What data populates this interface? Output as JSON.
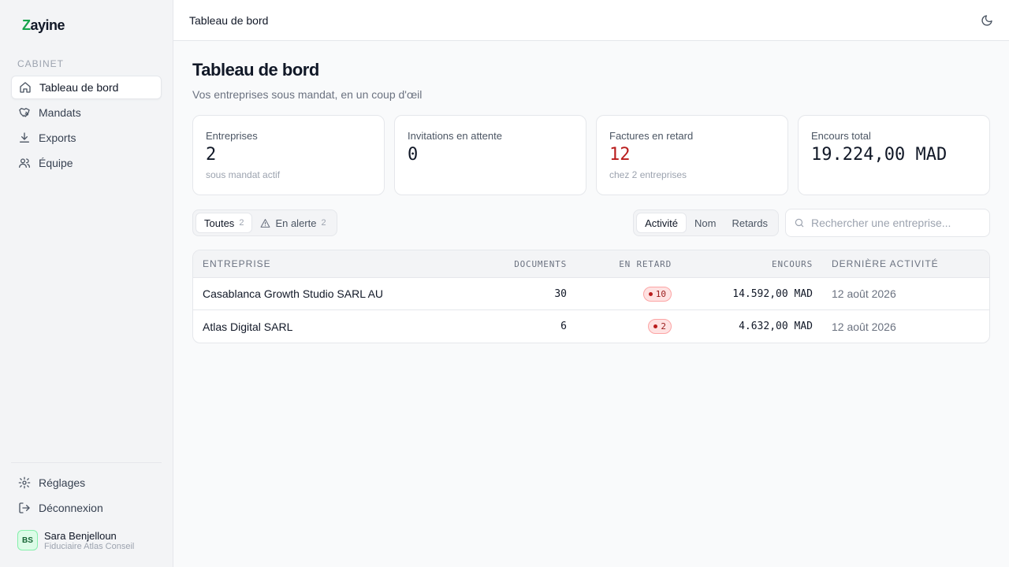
{
  "app": {
    "logo_z": "Z",
    "logo_rest": "ayine"
  },
  "sidebar": {
    "section": "CABINET",
    "items": [
      {
        "label": "Tableau de bord",
        "icon": "home-icon",
        "active": true
      },
      {
        "label": "Mandats",
        "icon": "handshake-icon"
      },
      {
        "label": "Exports",
        "icon": "download-icon"
      },
      {
        "label": "Équipe",
        "icon": "users-icon"
      }
    ],
    "bottom": [
      {
        "label": "Réglages",
        "icon": "gear-icon"
      },
      {
        "label": "Déconnexion",
        "icon": "logout-icon"
      }
    ],
    "user": {
      "initials": "BS",
      "name": "Sara Benjelloun",
      "org": "Fiduciaire Atlas Conseil"
    }
  },
  "topbar": {
    "title": "Tableau de bord",
    "icon": "moon-icon"
  },
  "page": {
    "title": "Tableau de bord",
    "subtitle": "Vos entreprises sous mandat, en un coup d'œil"
  },
  "cards": [
    {
      "label": "Entreprises",
      "value": "2",
      "sub": "sous mandat actif"
    },
    {
      "label": "Invitations en attente",
      "value": "0",
      "sub": ""
    },
    {
      "label": "Factures en retard",
      "value": "12",
      "sub": "chez 2 entreprises",
      "accent": "#b91c1c"
    },
    {
      "label": "Encours total",
      "value": "19.224,00 MAD",
      "sub": ""
    }
  ],
  "filters": {
    "all_label": "Toutes",
    "all_count": "2",
    "alert_label": "En alerte",
    "alert_count": "2"
  },
  "sort": {
    "options": [
      "Activité",
      "Nom",
      "Retards"
    ],
    "selected": "Activité"
  },
  "search": {
    "placeholder": "Rechercher une entreprise...",
    "value": ""
  },
  "table": {
    "headers": [
      "ENTREPRISE",
      "DOCUMENTS",
      "EN RETARD",
      "ENCOURS",
      "DERNIÈRE ACTIVITÉ"
    ],
    "rows": [
      {
        "name": "Casablanca Growth Studio SARL AU",
        "documents": "30",
        "late": "10",
        "encours": "14.592,00 MAD",
        "last": "12 août 2026"
      },
      {
        "name": "Atlas Digital SARL",
        "documents": "6",
        "late": "2",
        "encours": "4.632,00 MAD",
        "last": "12 août 2026"
      }
    ]
  }
}
